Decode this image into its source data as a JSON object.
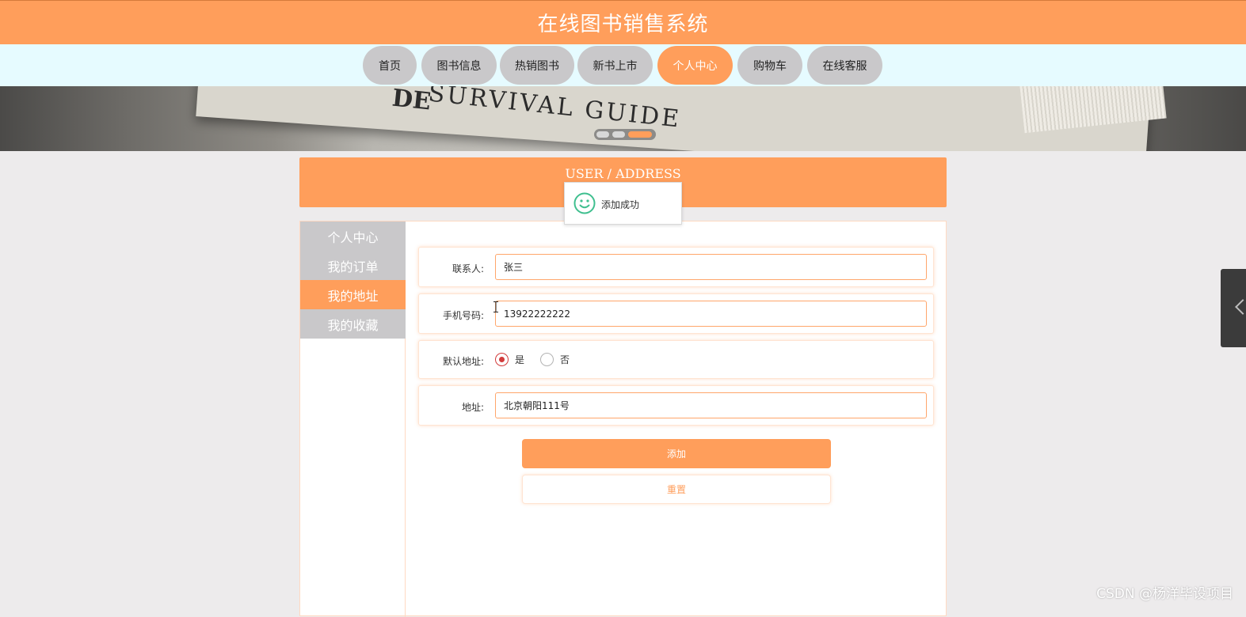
{
  "header": {
    "title": "在线图书销售系统"
  },
  "nav": {
    "items": [
      {
        "label": "首页",
        "active": false
      },
      {
        "label": "图书信息",
        "active": false
      },
      {
        "label": "热销图书",
        "active": false
      },
      {
        "label": "新书上市",
        "active": false
      },
      {
        "label": "个人中心",
        "active": true
      },
      {
        "label": "购物车",
        "active": false
      },
      {
        "label": "在线客服",
        "active": false
      }
    ]
  },
  "banner": {
    "text": "SURVIVAL GUIDE",
    "text_left": "DE",
    "slides": 3,
    "active_slide": 3
  },
  "section": {
    "title": "USER / ADDRESS"
  },
  "toast": {
    "icon": "smile-icon",
    "message": "添加成功"
  },
  "sidebar": {
    "items": [
      {
        "label": "个人中心",
        "active": false
      },
      {
        "label": "我的订单",
        "active": false
      },
      {
        "label": "我的地址",
        "active": true
      },
      {
        "label": "我的收藏",
        "active": false
      }
    ]
  },
  "form": {
    "contact": {
      "label": "联系人:",
      "value": "张三"
    },
    "phone": {
      "label": "手机号码:",
      "value": "13922222222"
    },
    "default_address": {
      "label": "默认地址:",
      "options": [
        {
          "label": "是",
          "checked": true
        },
        {
          "label": "否",
          "checked": false
        }
      ]
    },
    "address": {
      "label": "地址:",
      "value": "北京朝阳111号"
    },
    "add_button": "添加",
    "reset_button": "重置"
  },
  "watermark": "CSDN @杨洋毕设项目",
  "colors": {
    "accent": "#ff9e5b",
    "nav_inactive": "#c9c8ca",
    "nav_bar_bg": "#e6fbff",
    "page_bg": "#edebec"
  }
}
